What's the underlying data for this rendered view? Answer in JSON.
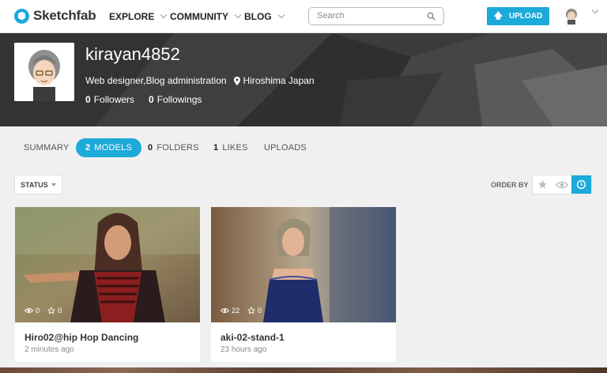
{
  "nav": {
    "logo_text": "Sketchfab",
    "links": [
      "EXPLORE",
      "COMMUNITY",
      "BLOG"
    ],
    "search_placeholder": "Search",
    "upload_label": "UPLOAD"
  },
  "profile": {
    "username": "kirayan4852",
    "bio": "Web designer,Blog administration",
    "location": "Hiroshima Japan",
    "followers_count": "0",
    "followers_label": "Followers",
    "followings_count": "0",
    "followings_label": "Followings"
  },
  "tabs": [
    {
      "count": "",
      "label": "SUMMARY"
    },
    {
      "count": "2",
      "label": "MODELS"
    },
    {
      "count": "0",
      "label": "FOLDERS"
    },
    {
      "count": "1",
      "label": "LIKES"
    },
    {
      "count": "",
      "label": "UPLOADS"
    }
  ],
  "filters": {
    "status_label": "STATUS",
    "order_label": "ORDER BY"
  },
  "models": [
    {
      "title": "Hiro02@hip Hop Dancing",
      "time": "2 minutes ago",
      "views": "0",
      "likes": "0"
    },
    {
      "title": "aki-02-stand-1",
      "time": "23 hours ago",
      "views": "22",
      "likes": "0"
    }
  ],
  "colors": {
    "accent": "#1caad9"
  }
}
